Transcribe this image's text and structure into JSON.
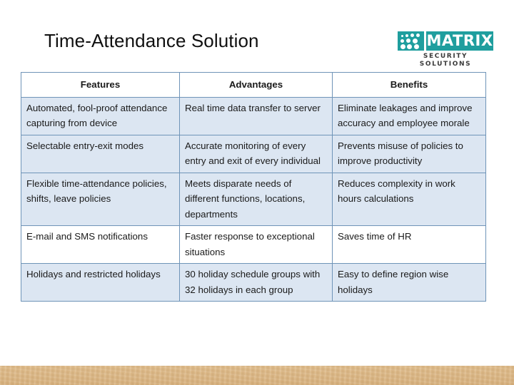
{
  "slide": {
    "title": "Time-Attendance Solution"
  },
  "logo": {
    "name": "matrix-logo",
    "wordmark": "MATRIX",
    "tagline": "SECURITY SOLUTIONS",
    "brand_color": "#1f9e9e",
    "icon": "dot-grid-icon"
  },
  "table": {
    "headers": [
      "Features",
      "Advantages",
      "Benefits"
    ],
    "rows": [
      {
        "shaded": true,
        "cells": [
          "Automated, fool-proof attendance capturing from device",
          "Real time data transfer to server",
          "Eliminate leakages and improve accuracy and employee morale"
        ]
      },
      {
        "shaded": true,
        "cells": [
          "Selectable entry-exit modes",
          "Accurate monitoring of every entry and exit of every individual",
          "Prevents misuse of policies to improve productivity"
        ]
      },
      {
        "shaded": true,
        "cells": [
          "Flexible time-attendance policies, shifts, leave policies",
          "Meets disparate needs of different functions, locations, departments",
          "Reduces complexity in work hours calculations"
        ]
      },
      {
        "shaded": false,
        "cells": [
          "E-mail and SMS notifications",
          "Faster response to exceptional situations",
          "Saves time of HR"
        ]
      },
      {
        "shaded": true,
        "cells": [
          "Holidays and restricted holidays",
          "30 holiday schedule groups with 32 holidays in each group",
          "Easy to define region wise holidays"
        ]
      }
    ]
  },
  "decor": {
    "bottom_band_color": "#dcb887"
  }
}
